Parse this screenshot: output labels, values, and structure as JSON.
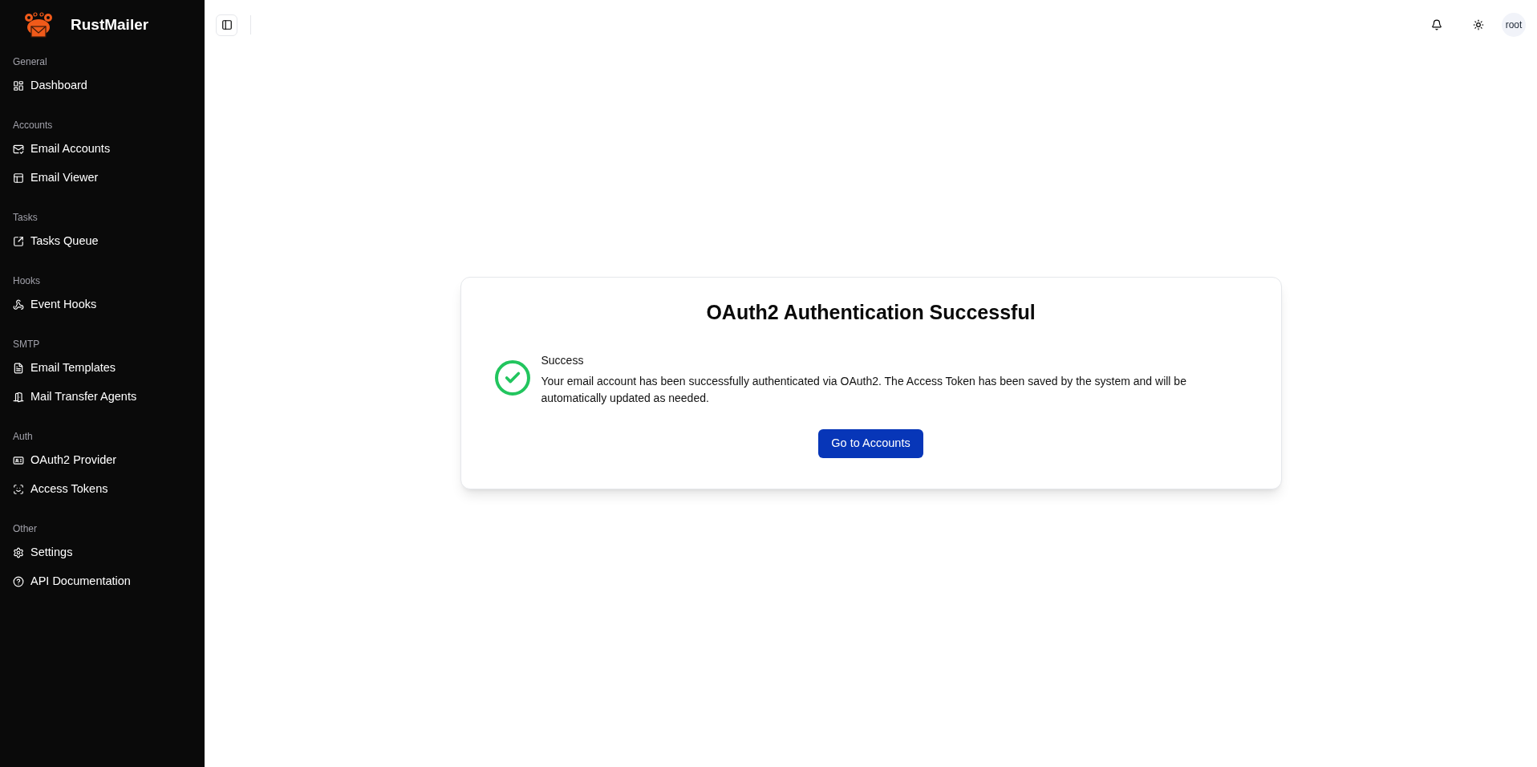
{
  "app": {
    "name": "RustMailer"
  },
  "sidebar": {
    "sections": [
      {
        "title": "General",
        "items": [
          {
            "label": "Dashboard"
          }
        ]
      },
      {
        "title": "Accounts",
        "items": [
          {
            "label": "Email Accounts"
          },
          {
            "label": "Email Viewer"
          }
        ]
      },
      {
        "title": "Tasks",
        "items": [
          {
            "label": "Tasks Queue"
          }
        ]
      },
      {
        "title": "Hooks",
        "items": [
          {
            "label": "Event Hooks"
          }
        ]
      },
      {
        "title": "SMTP",
        "items": [
          {
            "label": "Email Templates"
          },
          {
            "label": "Mail Transfer Agents"
          }
        ]
      },
      {
        "title": "Auth",
        "items": [
          {
            "label": "OAuth2 Provider"
          },
          {
            "label": "Access Tokens"
          }
        ]
      },
      {
        "title": "Other",
        "items": [
          {
            "label": "Settings"
          },
          {
            "label": "API Documentation"
          }
        ]
      }
    ]
  },
  "header": {
    "user": "root"
  },
  "card": {
    "title": "OAuth2 Authentication Successful",
    "status": "Success",
    "message": "Your email account has been successfully authenticated via OAuth2. The Access Token has been saved by the system and will be automatically updated as needed.",
    "button": "Go to Accounts"
  }
}
